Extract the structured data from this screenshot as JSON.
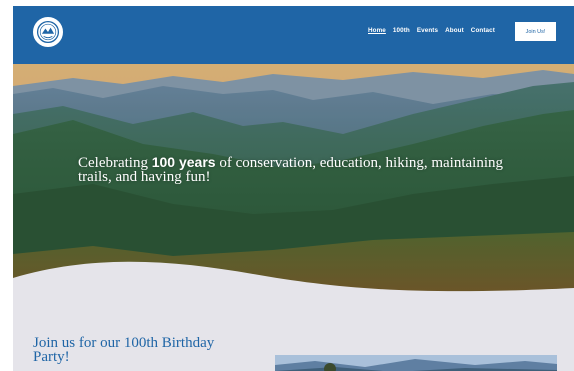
{
  "header": {
    "logo_label": "",
    "nav": [
      "Home",
      "100th",
      "Events",
      "About",
      "Contact"
    ],
    "active_nav": "Home",
    "cta_label": "Join Us!",
    "bg_color": "#1f65a6"
  },
  "hero": {
    "text_before": "Celebrating ",
    "text_bold": "100 years",
    "text_after": " of conservation, education, hiking, maintaining trails, and having fun!",
    "image": "mountain-landscape"
  },
  "section": {
    "title": "Join us for our 100th Birthday Party!",
    "image": "mountain-photo",
    "bg_color": "#e5e4ea"
  }
}
